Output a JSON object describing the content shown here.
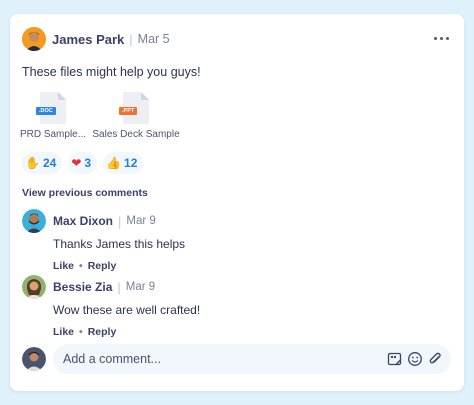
{
  "post": {
    "author": "James Park",
    "separator": "|",
    "date": "Mar 5",
    "text": "These files might help you guys!",
    "files": [
      {
        "name": "PRD Sample...",
        "type_label": ".DOC",
        "color": "#2f86e0"
      },
      {
        "name": "Sales Deck Sample",
        "type_label": ".PPT",
        "color": "#f0732e"
      }
    ],
    "reactions": [
      {
        "emoji": "✋",
        "icon": "raised-hand-icon",
        "count": "24"
      },
      {
        "emoji": "❤",
        "icon": "heart-icon",
        "count": "3"
      },
      {
        "emoji": "👍",
        "icon": "thumbs-up-icon",
        "count": "12"
      }
    ]
  },
  "comments_section": {
    "view_previous": "View previous comments",
    "comments": [
      {
        "author": "Max Dixon",
        "date": "Mar 9",
        "text": "Thanks James this helps",
        "like": "Like",
        "bullet": "•",
        "reply": "Reply"
      },
      {
        "author": "Bessie Zia",
        "date": "Mar 9",
        "text": "Wow these are well crafted!",
        "like": "Like",
        "bullet": "•",
        "reply": "Reply"
      }
    ]
  },
  "composer": {
    "placeholder": "Add a comment...",
    "tools": [
      "gif-icon",
      "emoji-icon",
      "attach-icon"
    ]
  },
  "colors": {
    "background": "#dff1fa",
    "accent": "#2a7bd6",
    "name_text": "#3b3f6b"
  }
}
